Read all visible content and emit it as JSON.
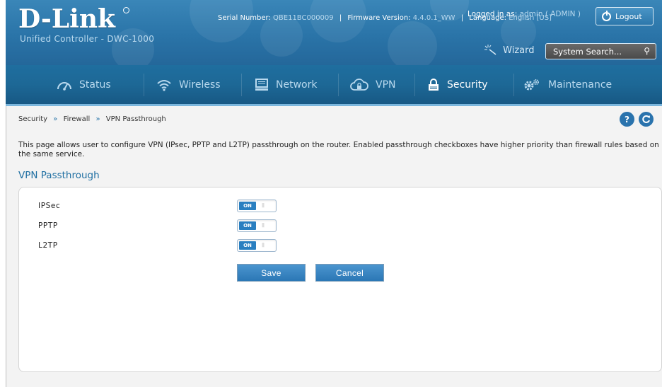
{
  "brand": {
    "logo": "D-Link",
    "product": "Unified Controller - DWC-1000"
  },
  "header": {
    "serial_label": "Serial Number:",
    "serial_value": "QBE11BC000009",
    "firmware_label": "Firmware Version:",
    "firmware_value": "4.4.0.1_WW",
    "language_label": "Language:",
    "language_value": "English [US]",
    "logged_label": "Logged in as:",
    "logged_value": "admin ( ADMIN )",
    "logout_label": "Logout",
    "wizard_label": "Wizard",
    "search_placeholder": "System Search..."
  },
  "nav": {
    "items": [
      {
        "label": "Status",
        "icon": "dashboard-icon"
      },
      {
        "label": "Wireless",
        "icon": "wifi-icon"
      },
      {
        "label": "Network",
        "icon": "monitor-icon"
      },
      {
        "label": "VPN",
        "icon": "cloud-lock-icon"
      },
      {
        "label": "Security",
        "icon": "lock-icon",
        "active": true
      },
      {
        "label": "Maintenance",
        "icon": "gears-icon"
      }
    ]
  },
  "breadcrumb": {
    "items": [
      "Security",
      "Firewall",
      "VPN Passthrough"
    ],
    "separator": "»"
  },
  "description": "This page allows user to configure VPN (IPsec, PPTP and L2TP) passthrough on the router. Enabled passthrough checkboxes have higher priority than firewall rules based on the same service.",
  "section_title": "VPN Passthrough",
  "settings": [
    {
      "label": "IPSec",
      "state": "ON"
    },
    {
      "label": "PPTP",
      "state": "ON"
    },
    {
      "label": "L2TP",
      "state": "ON"
    }
  ],
  "buttons": {
    "save": "Save",
    "cancel": "Cancel"
  },
  "colors": {
    "header_blue": "#2a74a8",
    "nav_blue": "#1d6896",
    "accent": "#1f6fa2",
    "button": "#2b77b5"
  }
}
